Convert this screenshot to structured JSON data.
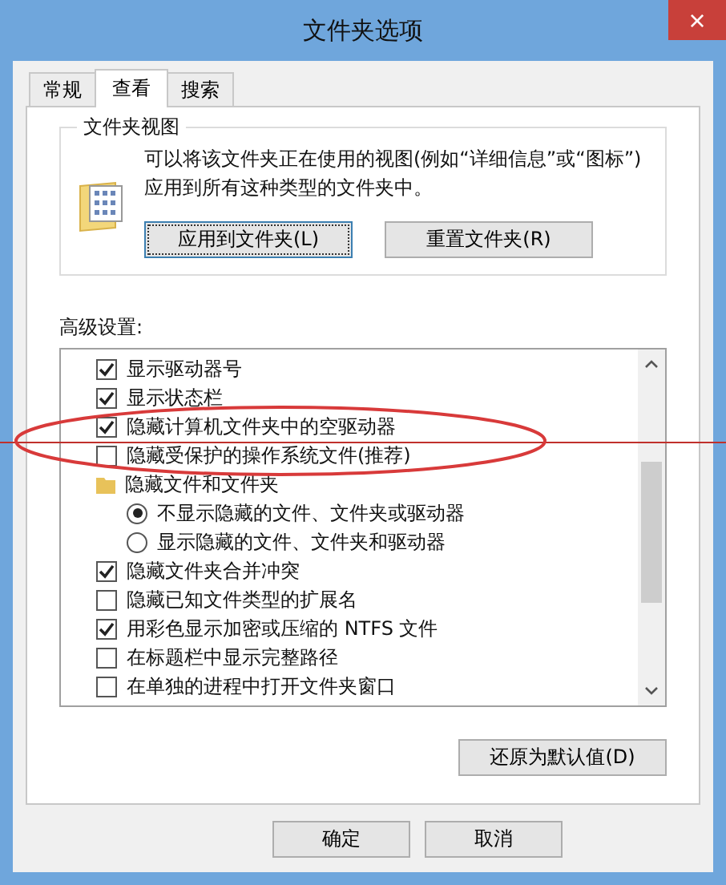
{
  "window": {
    "title": "文件夹选项",
    "close": "×"
  },
  "tabs": [
    {
      "label": "常规",
      "selected": false
    },
    {
      "label": "查看",
      "selected": true
    },
    {
      "label": "搜索",
      "selected": false
    }
  ],
  "folder_views": {
    "title": "文件夹视图",
    "description": "可以将该文件夹正在使用的视图(例如“详细信息”或“图标”)应用到所有这种类型的文件夹中。",
    "buttons": [
      {
        "label": "应用到文件夹(L)",
        "focused": true
      },
      {
        "label": "重置文件夹(R)",
        "focused": false
      }
    ]
  },
  "advanced": {
    "label": "高级设置:",
    "items": [
      {
        "kind": "checkbox",
        "label": "显示驱动器号",
        "checked": true
      },
      {
        "kind": "checkbox",
        "label": "显示状态栏",
        "checked": true
      },
      {
        "kind": "checkbox",
        "label": "隐藏计算机文件夹中的空驱动器",
        "checked": true
      },
      {
        "kind": "checkbox",
        "label": "隐藏受保护的操作系统文件(推荐)",
        "checked": false
      },
      {
        "kind": "folder",
        "label": "隐藏文件和文件夹"
      },
      {
        "kind": "radio",
        "label": "不显示隐藏的文件、文件夹或驱动器",
        "selected": true
      },
      {
        "kind": "radio",
        "label": "显示隐藏的文件、文件夹和驱动器",
        "selected": false
      },
      {
        "kind": "checkbox",
        "label": "隐藏文件夹合并冲突",
        "checked": true
      },
      {
        "kind": "checkbox",
        "label": "隐藏已知文件类型的扩展名",
        "checked": false
      },
      {
        "kind": "checkbox",
        "label": "用彩色显示加密或压缩的 NTFS 文件",
        "checked": true
      },
      {
        "kind": "checkbox",
        "label": "在标题栏中显示完整路径",
        "checked": false
      },
      {
        "kind": "checkbox",
        "label": "在单独的进程中打开文件夹窗口",
        "checked": false
      }
    ],
    "restore_button": "还原为默认值(D)"
  },
  "footer_buttons": [
    "确定",
    "取消"
  ]
}
